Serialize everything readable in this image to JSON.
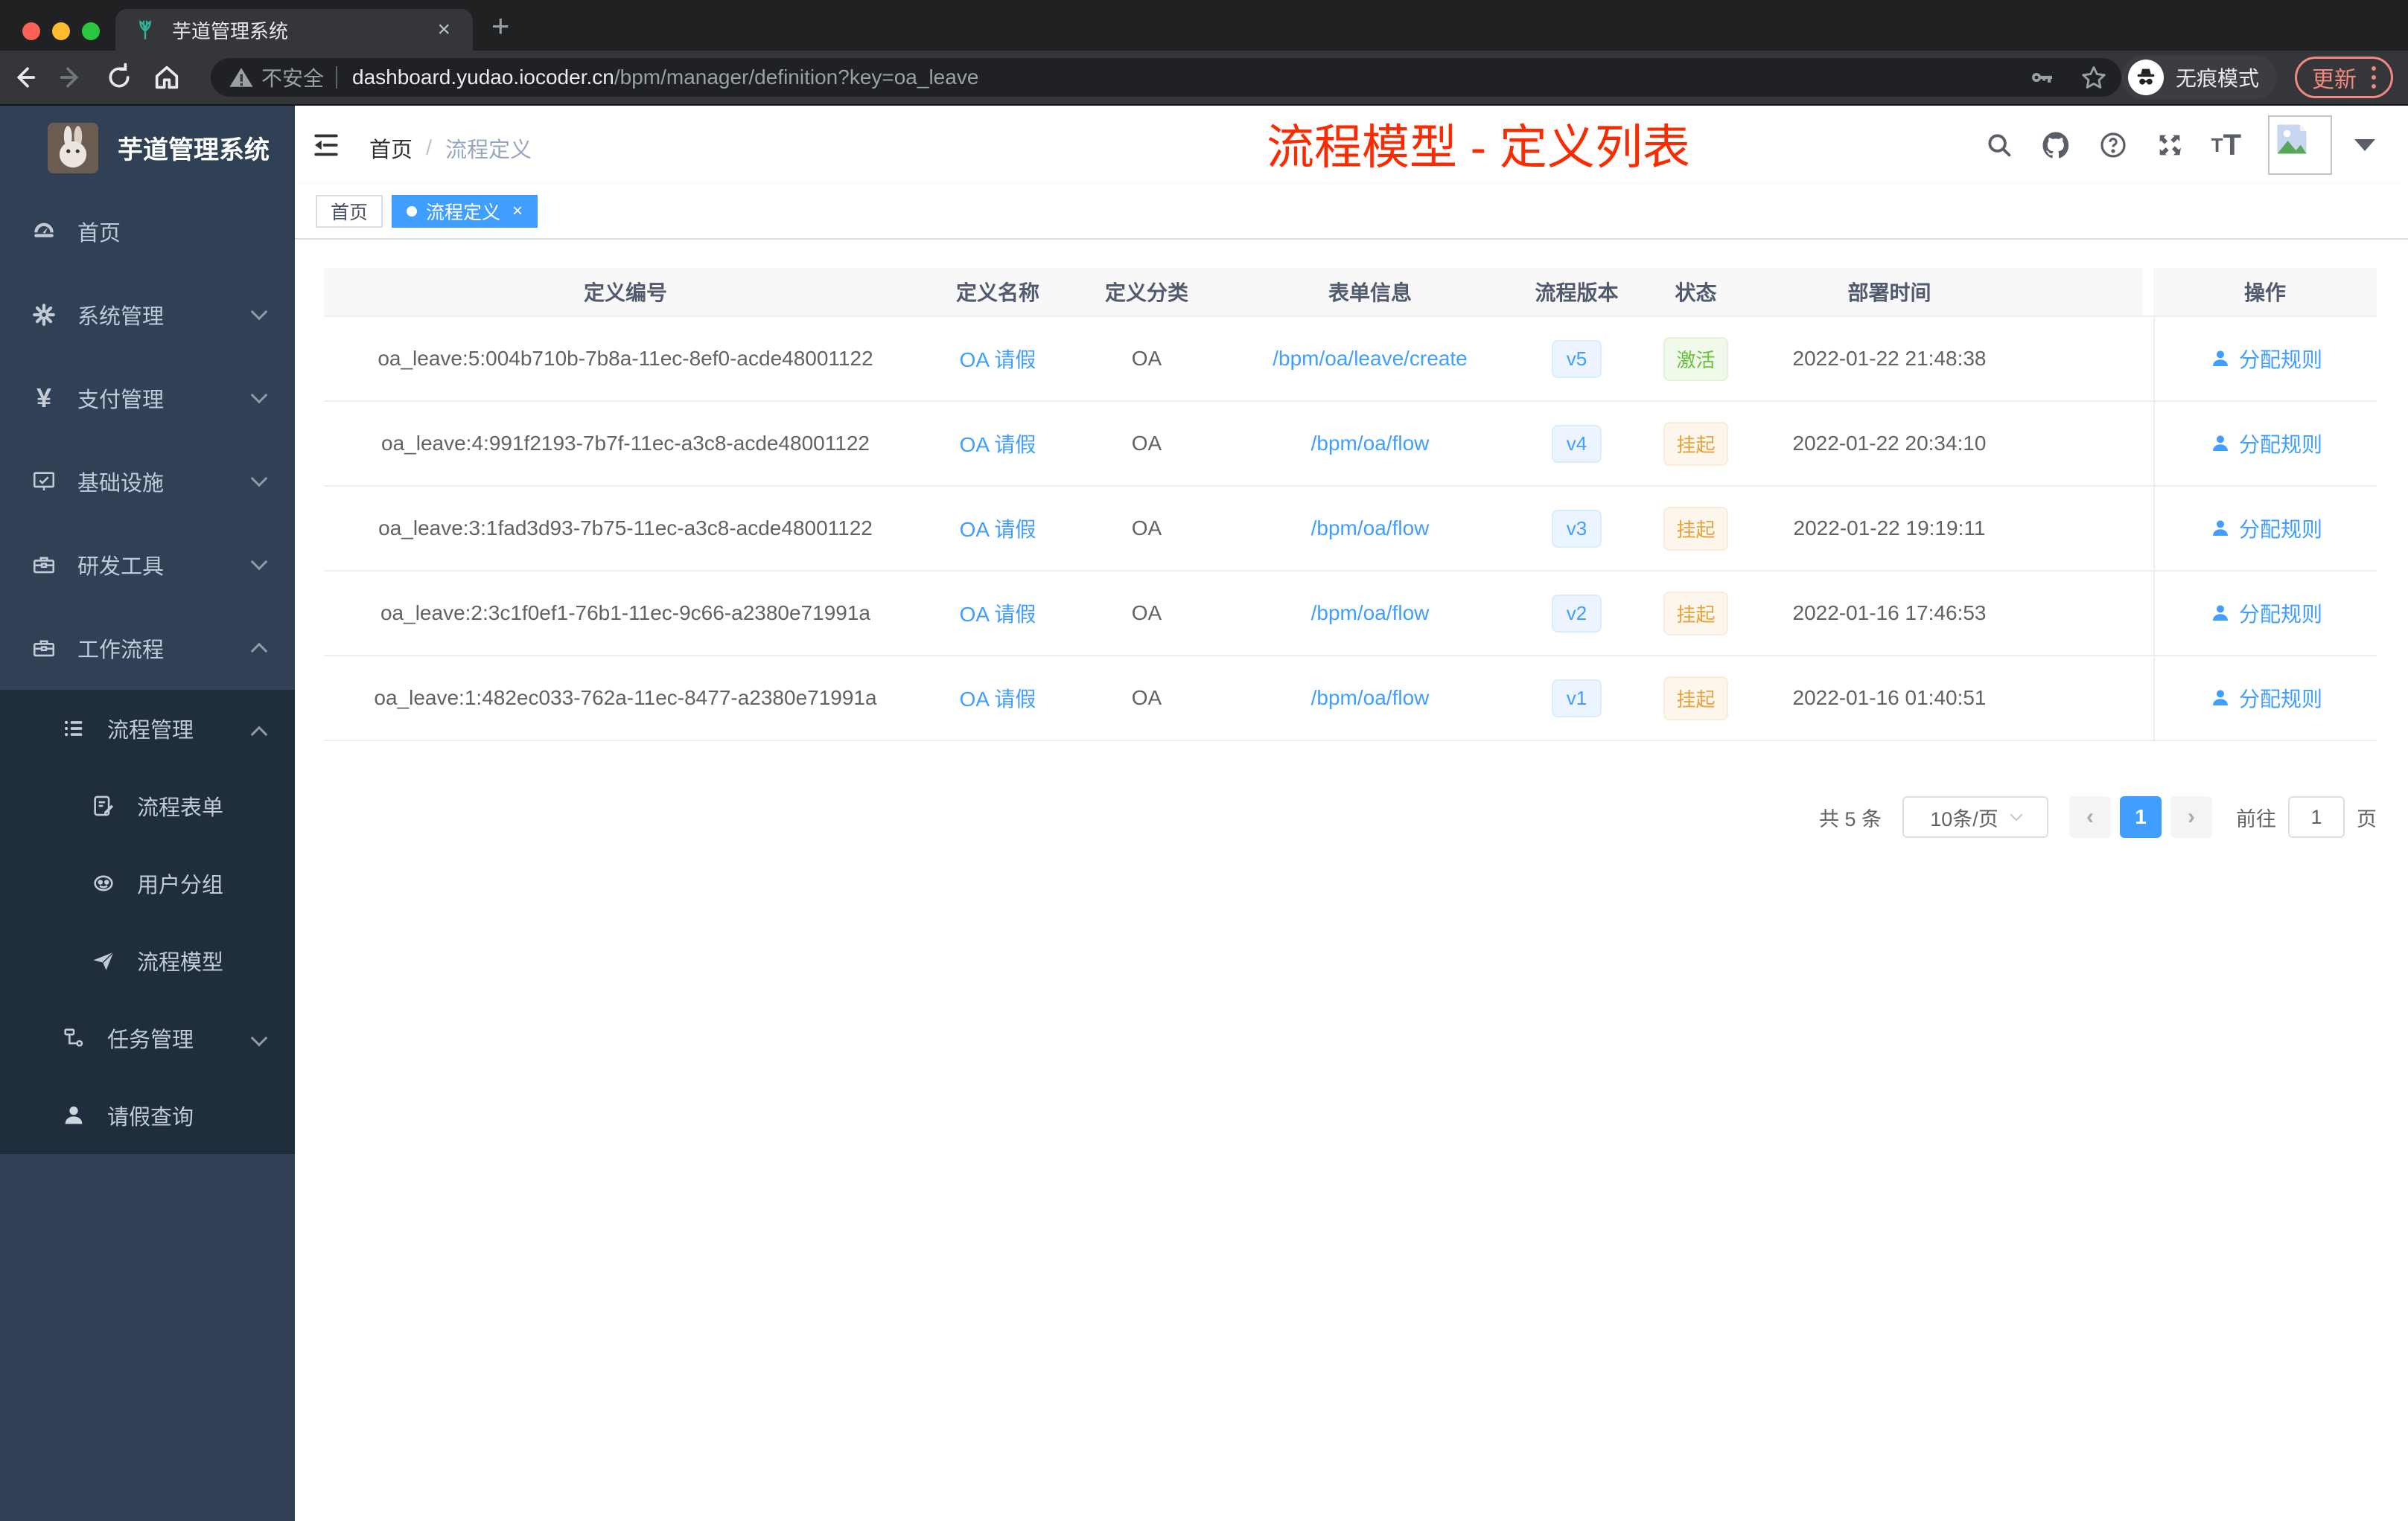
{
  "browser": {
    "tab_title": "芋道管理系统",
    "new_tab": "+",
    "close_tab": "×",
    "security_label": "不安全",
    "url_host": "dashboard.yudao.iocoder.cn",
    "url_path": "/bpm/manager/definition?key=oa_leave",
    "incognito_label": "无痕模式",
    "update_label": "更新"
  },
  "sidebar": {
    "app_title": "芋道管理系统",
    "items": [
      {
        "label": "首页"
      },
      {
        "label": "系统管理"
      },
      {
        "label": "支付管理"
      },
      {
        "label": "基础设施"
      },
      {
        "label": "研发工具"
      },
      {
        "label": "工作流程"
      },
      {
        "label": "流程管理"
      },
      {
        "label": "流程表单"
      },
      {
        "label": "用户分组"
      },
      {
        "label": "流程模型"
      },
      {
        "label": "任务管理"
      },
      {
        "label": "请假查询"
      }
    ]
  },
  "header": {
    "breadcrumb_home": "首页",
    "breadcrumb_sep": "/",
    "breadcrumb_current": "流程定义",
    "annotation_title": "流程模型 - 定义列表"
  },
  "tags": [
    {
      "label": "首页"
    },
    {
      "label": "流程定义"
    }
  ],
  "table": {
    "columns": [
      "定义编号",
      "定义名称",
      "定义分类",
      "表单信息",
      "流程版本",
      "状态",
      "部署时间",
      "操作"
    ],
    "rows": [
      {
        "id": "oa_leave:5:004b710b-7b8a-11ec-8ef0-acde48001122",
        "name": "OA 请假",
        "category": "OA",
        "form": "/bpm/oa/leave/create",
        "version": "v5",
        "status": "激活",
        "deploy_time": "2022-01-22 21:48:38",
        "action_label": "分配规则"
      },
      {
        "id": "oa_leave:4:991f2193-7b7f-11ec-a3c8-acde48001122",
        "name": "OA 请假",
        "category": "OA",
        "form": "/bpm/oa/flow",
        "version": "v4",
        "status": "挂起",
        "deploy_time": "2022-01-22 20:34:10",
        "action_label": "分配规则"
      },
      {
        "id": "oa_leave:3:1fad3d93-7b75-11ec-a3c8-acde48001122",
        "name": "OA 请假",
        "category": "OA",
        "form": "/bpm/oa/flow",
        "version": "v3",
        "status": "挂起",
        "deploy_time": "2022-01-22 19:19:11",
        "action_label": "分配规则"
      },
      {
        "id": "oa_leave:2:3c1f0ef1-76b1-11ec-9c66-a2380e71991a",
        "name": "OA 请假",
        "category": "OA",
        "form": "/bpm/oa/flow",
        "version": "v2",
        "status": "挂起",
        "deploy_time": "2022-01-16 17:46:53",
        "action_label": "分配规则"
      },
      {
        "id": "oa_leave:1:482ec033-762a-11ec-8477-a2380e71991a",
        "name": "OA 请假",
        "category": "OA",
        "form": "/bpm/oa/flow",
        "version": "v1",
        "status": "挂起",
        "deploy_time": "2022-01-16 01:40:51",
        "action_label": "分配规则"
      }
    ]
  },
  "pagination": {
    "total_label": "共 5 条",
    "page_size": "10条/页",
    "prev": "‹",
    "current_page": "1",
    "next": "›",
    "goto_label": "前往",
    "goto_value": "1",
    "page_unit": "页"
  },
  "colors": {
    "accent_blue": "#409eff",
    "success_green": "#67c23a",
    "warning_orange": "#e6a23c",
    "annotation_red": "#fb2b01",
    "sidebar_bg": "#304156",
    "submenu_bg": "#1f2d3d"
  }
}
